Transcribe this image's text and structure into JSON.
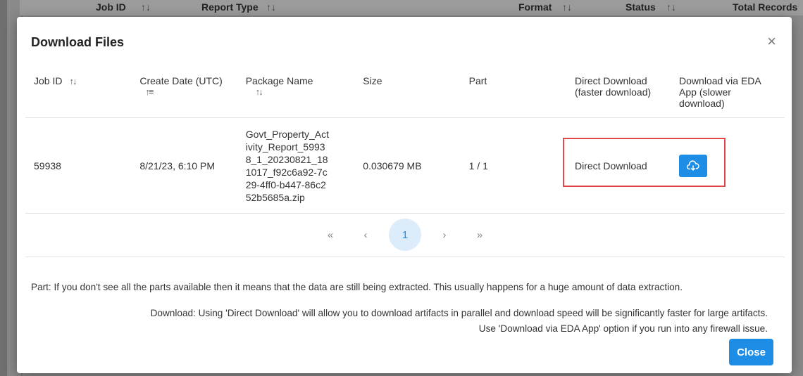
{
  "background": {
    "columns": [
      "Job ID",
      "Report Type",
      "Format",
      "Status",
      "Total Records"
    ],
    "sort_glyph": "↑↓"
  },
  "modal": {
    "title": "Download Files",
    "close_x": "×",
    "columns": {
      "job_id": "Job ID",
      "create_date": "Create Date (UTC)",
      "package_name": "Package Name",
      "size": "Size",
      "part": "Part",
      "direct_download": "Direct Download (faster download)",
      "eda_download": "Download via EDA App (slower download)"
    },
    "rows": [
      {
        "job_id": "59938",
        "create_date": "8/21/23, 6:10 PM",
        "package_name": "Govt_Property_Activity_Report_59938_1_20230821_181017_f92c6a92-7c29-4ff0-b447-86c252b5685a.zip",
        "size": "0.030679 MB",
        "part": "1 / 1",
        "direct_download_label": "Direct Download"
      }
    ],
    "pagination": {
      "first": "«",
      "prev": "‹",
      "current": "1",
      "next": "›",
      "last": "»"
    },
    "note_part": "Part: If you don't see all the parts available then it means that the data are still being extracted. This usually happens for a huge amount of data extraction.",
    "note_download_1": "Download: Using 'Direct Download' will allow you to download artifacts in parallel and download speed will be significantly faster for large artifacts.",
    "note_download_2": "Use 'Download via EDA App' option if you run into any firewall issue.",
    "close_button": "Close"
  },
  "colors": {
    "accent": "#1e8de6",
    "highlight": "#e04848"
  }
}
